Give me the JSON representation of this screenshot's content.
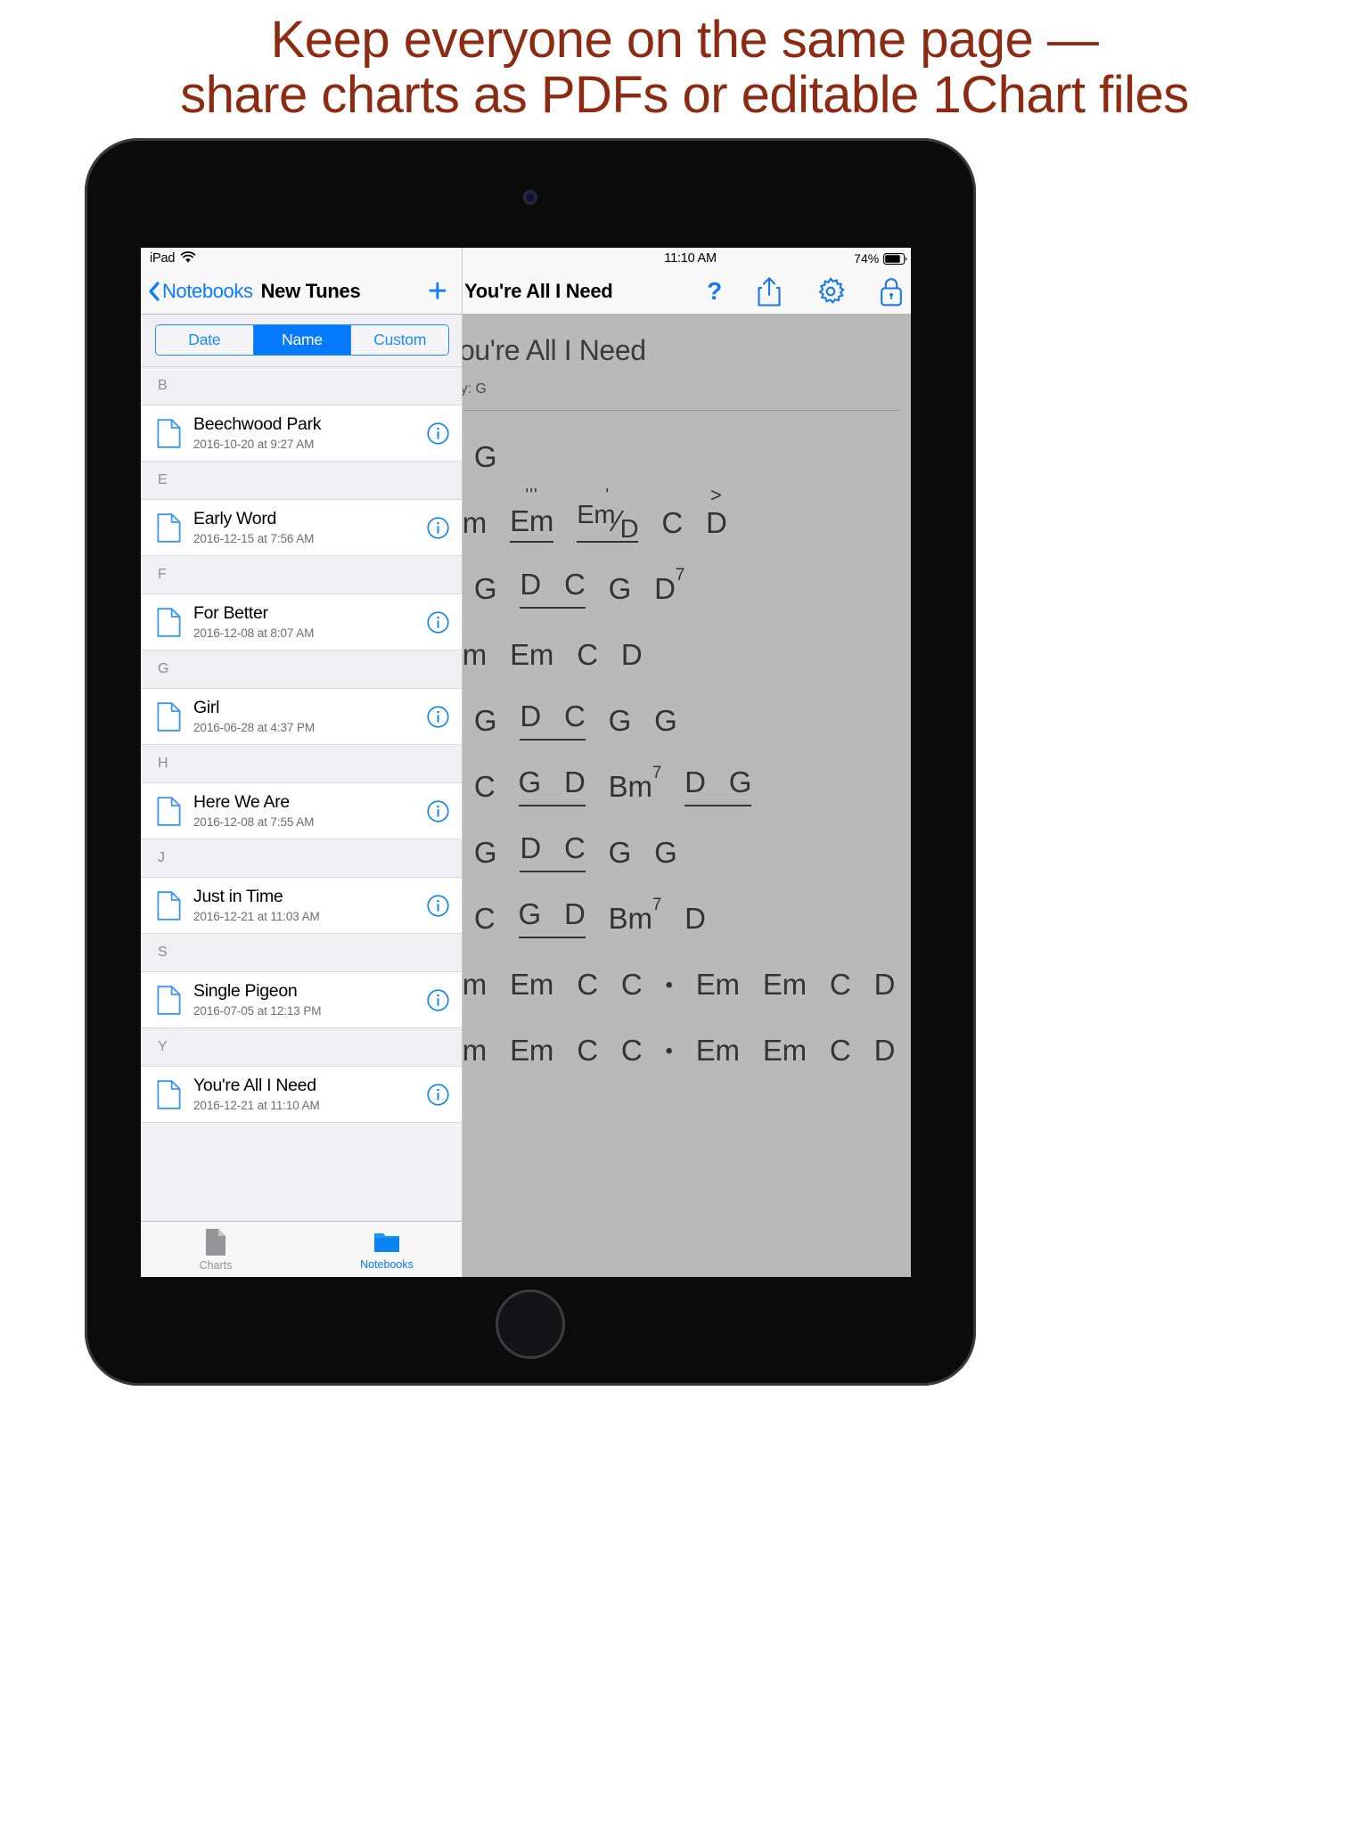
{
  "headline": {
    "line1": "Keep everyone on the same page —",
    "line2": "share charts as PDFs or editable 1Chart files",
    "color": "#8c2a12"
  },
  "left_pane": {
    "status_bar": {
      "device_label": "iPad",
      "wifi_icon": "wifi-icon"
    },
    "nav_bar": {
      "back_icon": "chevron-left-icon",
      "back_label": "Notebooks",
      "title": "New Tunes",
      "add_icon": "plus-icon"
    },
    "segmented_control": {
      "options": [
        "Date",
        "Name",
        "Custom"
      ],
      "selected": "Name",
      "selected_color": "#067aff"
    },
    "list": [
      {
        "type": "section",
        "letter": "B"
      },
      {
        "type": "item",
        "title": "Beechwood Park",
        "date": "2016-10-20 at 9:27 AM",
        "icon": "document-icon",
        "info_icon": "info-icon"
      },
      {
        "type": "section",
        "letter": "E"
      },
      {
        "type": "item",
        "title": "Early Word",
        "date": "2016-12-15 at 7:56 AM",
        "icon": "document-icon",
        "info_icon": "info-icon"
      },
      {
        "type": "section",
        "letter": "F"
      },
      {
        "type": "item",
        "title": "For Better",
        "date": "2016-12-08 at 8:07 AM",
        "icon": "document-icon",
        "info_icon": "info-icon"
      },
      {
        "type": "section",
        "letter": "G"
      },
      {
        "type": "item",
        "title": "Girl",
        "date": "2016-06-28 at 4:37 PM",
        "icon": "document-icon",
        "info_icon": "info-icon"
      },
      {
        "type": "section",
        "letter": "H"
      },
      {
        "type": "item",
        "title": "Here We Are",
        "date": "2016-12-08 at 7:55 AM",
        "icon": "document-icon",
        "info_icon": "info-icon"
      },
      {
        "type": "section",
        "letter": "J"
      },
      {
        "type": "item",
        "title": "Just in Time",
        "date": "2016-12-21 at 11:03 AM",
        "icon": "document-icon",
        "info_icon": "info-icon"
      },
      {
        "type": "section",
        "letter": "S"
      },
      {
        "type": "item",
        "title": "Single Pigeon",
        "date": "2016-07-05 at 12:13 PM",
        "icon": "document-icon",
        "info_icon": "info-icon"
      },
      {
        "type": "section",
        "letter": "Y"
      },
      {
        "type": "item",
        "title": "You're All I Need",
        "date": "2016-12-21 at 11:10 AM",
        "icon": "document-icon",
        "info_icon": "info-icon"
      }
    ],
    "tab_bar": {
      "tabs": [
        {
          "label": "Charts",
          "icon": "document-icon",
          "active": false
        },
        {
          "label": "Notebooks",
          "icon": "folder-icon",
          "active": true
        }
      ],
      "active_color": "#067aff",
      "inactive_color": "#929296"
    }
  },
  "right_pane": {
    "status_bar": {
      "time": "11:10 AM",
      "battery_percent": "74%",
      "battery_icon": "battery-icon"
    },
    "nav_bar": {
      "title": "You're All I Need",
      "tools": [
        {
          "name": "help-icon",
          "glyph": "?"
        },
        {
          "name": "share-icon"
        },
        {
          "name": "settings-gear-icon"
        },
        {
          "name": "lock-icon"
        }
      ],
      "tint": "#1678e8"
    },
    "chart": {
      "title": "You're All I Need",
      "key_label": "Key: G",
      "lines": [
        {
          "bullet": true,
          "chords": [
            {
              "text": "G"
            }
          ]
        },
        {
          "bullet": false,
          "chords": [
            {
              "text": "Em"
            },
            {
              "text": "Em",
              "underline": true,
              "mark": "'''"
            },
            {
              "text": "Em/D",
              "slash": true,
              "underline": true,
              "mark": "'"
            },
            {
              "text": "C"
            },
            {
              "text": "D",
              "mark": ">"
            }
          ]
        },
        {
          "bullet": true,
          "chords": [
            {
              "text": "G"
            },
            {
              "text": "D",
              "group_underline": true
            },
            {
              "text": "C",
              "group_underline": true
            },
            {
              "text": "G"
            },
            {
              "text": "D",
              "sup": "7"
            }
          ]
        },
        {
          "bullet": false,
          "chords": [
            {
              "text": "Em"
            },
            {
              "text": "Em"
            },
            {
              "text": "C"
            },
            {
              "text": "D"
            }
          ]
        },
        {
          "bullet": true,
          "chords": [
            {
              "text": "G"
            },
            {
              "text": "D",
              "group_underline": true
            },
            {
              "text": "C",
              "group_underline": true
            },
            {
              "text": "G"
            },
            {
              "text": "G"
            }
          ]
        },
        {
          "bullet": true,
          "chords": [
            {
              "text": "C"
            },
            {
              "text": "G",
              "group_underline": true
            },
            {
              "text": "D",
              "group_underline": true
            },
            {
              "text": "Bm",
              "sup": "7"
            },
            {
              "text": "D",
              "group_underline": true
            },
            {
              "text": "G",
              "group_underline": true
            }
          ]
        },
        {
          "bullet": true,
          "chords": [
            {
              "text": "G"
            },
            {
              "text": "D",
              "group_underline": true
            },
            {
              "text": "C",
              "group_underline": true
            },
            {
              "text": "G"
            },
            {
              "text": "G"
            }
          ]
        },
        {
          "bullet": true,
          "chords": [
            {
              "text": "C"
            },
            {
              "text": "G",
              "group_underline": true
            },
            {
              "text": "D",
              "group_underline": true
            },
            {
              "text": "Bm",
              "sup": "7"
            },
            {
              "text": "D"
            }
          ]
        },
        {
          "bullet": false,
          "chords": [
            {
              "text": "Em"
            },
            {
              "text": "Em"
            },
            {
              "text": "C"
            },
            {
              "text": "C"
            },
            {
              "dot": true
            },
            {
              "text": "Em"
            },
            {
              "text": "Em"
            },
            {
              "text": "C"
            },
            {
              "text": "D"
            }
          ]
        },
        {
          "bullet": false,
          "chords": [
            {
              "text": "Em"
            },
            {
              "text": "Em"
            },
            {
              "text": "C"
            },
            {
              "text": "C"
            },
            {
              "dot": true
            },
            {
              "text": "Em"
            },
            {
              "text": "Em"
            },
            {
              "text": "C"
            },
            {
              "text": "D"
            }
          ]
        }
      ]
    }
  }
}
